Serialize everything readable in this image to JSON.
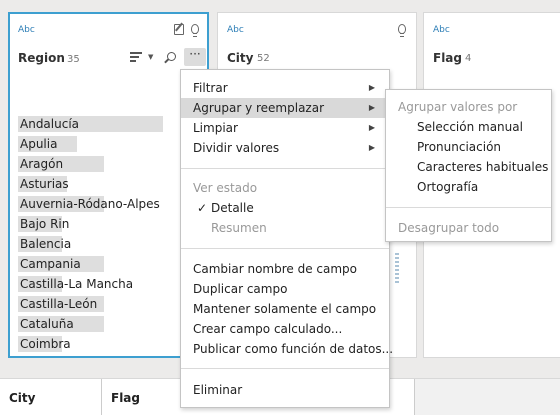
{
  "cards": {
    "region": {
      "type_label": "Abc",
      "name": "Region",
      "count": "35"
    },
    "city": {
      "type_label": "Abc",
      "name": "City",
      "count": "52"
    },
    "flag": {
      "type_label": "Abc",
      "name": "Flag",
      "count": "4"
    }
  },
  "region_values": [
    {
      "label": "Andalucía",
      "bar": 1.0
    },
    {
      "label": "Apulia",
      "bar": 0.41
    },
    {
      "label": "Aragón",
      "bar": 0.59
    },
    {
      "label": "Asturias",
      "bar": 0.34
    },
    {
      "label": "Auvernia-Ródano-Alpes",
      "bar": 0.59
    },
    {
      "label": "Bajo Rin",
      "bar": 0.3
    },
    {
      "label": "Balencia",
      "bar": 0.3
    },
    {
      "label": "Campania",
      "bar": 0.59
    },
    {
      "label": "Castilla-La Mancha",
      "bar": 0.3
    },
    {
      "label": "Castilla-León",
      "bar": 0.59
    },
    {
      "label": "Cataluña",
      "bar": 0.59
    },
    {
      "label": "Coimbra",
      "bar": 0.3
    }
  ],
  "menu": {
    "filter": "Filtrar",
    "group_replace": "Agrupar y reemplazar",
    "clean": "Limpiar",
    "split": "Dividir valores",
    "view_state": "Ver estado",
    "detail": "Detalle",
    "summary": "Resumen",
    "rename": "Cambiar nombre de campo",
    "duplicate": "Duplicar campo",
    "keep_only": "Mantener solamente el campo",
    "calc_field": "Crear campo calculado...",
    "publish": "Publicar como función de datos...",
    "delete": "Eliminar",
    "arrow": "▶",
    "check": "✓"
  },
  "submenu": {
    "header": "Agrupar valores por",
    "manual": "Selección manual",
    "pronunciation": "Pronunciación",
    "common_chars": "Caracteres habituales",
    "spelling": "Ortografía",
    "ungroup_all": "Desagrupar todo"
  },
  "bottom_columns": {
    "city": "City",
    "flag": "Flag"
  },
  "more_button": "···"
}
